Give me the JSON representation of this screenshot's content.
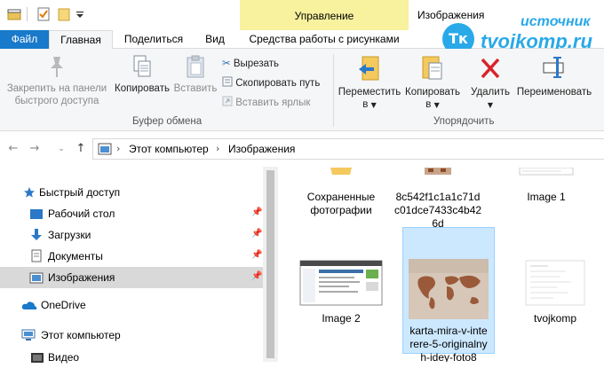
{
  "titlebar": {
    "context_group": "Управление",
    "window_title": "Изображения"
  },
  "watermark": {
    "logo": "Тк",
    "top_text": "источник",
    "main_text": "tvojkomp.ru"
  },
  "tabs": {
    "file": "Файл",
    "home": "Главная",
    "share": "Поделиться",
    "view": "Вид",
    "picture_tools": "Средства работы с рисунками"
  },
  "ribbon": {
    "pin": [
      "Закрепить на панели",
      "быстрого доступа"
    ],
    "copy": "Копировать",
    "paste": "Вставить",
    "cut": "Вырезать",
    "copy_path": "Скопировать путь",
    "paste_shortcut": "Вставить ярлык",
    "clipboard_group": "Буфер обмена",
    "move_to": [
      "Переместить",
      "в"
    ],
    "copy_to": [
      "Копировать",
      "в"
    ],
    "delete": "Удалить",
    "rename": "Переименовать",
    "organize_group": "Упорядочить"
  },
  "address": {
    "segments": [
      "Этот компьютер",
      "Изображения"
    ]
  },
  "nav": {
    "items": [
      {
        "label": "Быстрый доступ",
        "icon": "star-icon"
      },
      {
        "label": "Рабочий стол",
        "icon": "desktop-icon"
      },
      {
        "label": "Загрузки",
        "icon": "download-icon"
      },
      {
        "label": "Документы",
        "icon": "documents-icon"
      },
      {
        "label": "Изображения",
        "icon": "pictures-icon"
      },
      {
        "label": "OneDrive",
        "icon": "cloud-icon"
      },
      {
        "label": "Этот компьютер",
        "icon": "computer-icon"
      },
      {
        "label": "Видео",
        "icon": "video-icon"
      }
    ]
  },
  "files": {
    "saved_photos": [
      "Сохраненные",
      "фотографии"
    ],
    "hash_file": [
      "8c542f1c1a1c71d",
      "c01dce7433c4b42",
      "6d"
    ],
    "image1": "Image 1",
    "image2": "Image 2",
    "karta": [
      "karta-mira-v-inte",
      "rere-5-originalny",
      "h-idey-foto8"
    ],
    "tvojkomp": "tvojkomp"
  },
  "colors": {
    "file_tab": "#1979ca",
    "context_tab": "#f8f19e",
    "selection": "#cce8ff",
    "watermark": "#29a9e8"
  }
}
